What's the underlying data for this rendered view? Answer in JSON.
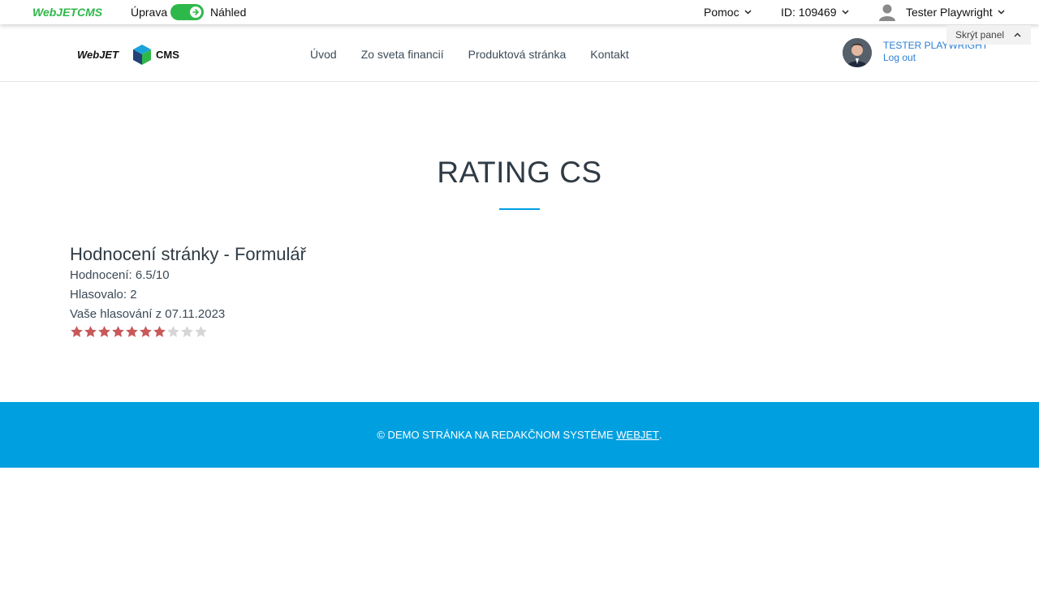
{
  "admin_bar": {
    "logo_text": "WebJETCMS",
    "edit_label": "Úprava",
    "preview_label": "Náhled",
    "toggle_on": true,
    "help_label": "Pomoc",
    "doc_id_label": "ID: 109469",
    "user_label": "Tester Playwright",
    "hide_panel_label": "Skrýt panel",
    "accent_color": "#2fb84a"
  },
  "header": {
    "logo_text_left": "WebJET",
    "logo_text_right": "CMS",
    "nav": [
      {
        "label": "Úvod"
      },
      {
        "label": "Zo sveta financií"
      },
      {
        "label": "Produktová stránka"
      },
      {
        "label": "Kontakt"
      }
    ],
    "user_name": "Tester Playwright",
    "logout_label": "Log out"
  },
  "main": {
    "title": "RATING CS",
    "rating": {
      "heading": "Hodnocení stránky - Formulář",
      "score_line": "Hodnocení: 6.5/10",
      "votes_line": "Hlasovalo: 2",
      "your_vote_line": "Vaše hlasování z 07.11.2023",
      "stars_total": 10,
      "stars_filled": 7,
      "star_filled_color": "#c9585a",
      "star_empty_color": "#d6d6d6"
    },
    "divider_color": "#009fe3"
  },
  "footer": {
    "text_prefix": "© Demo stránka na redakčnom systéme ",
    "link_text": "WebJET",
    "text_suffix": ".",
    "bg_color": "#00a0e0"
  }
}
